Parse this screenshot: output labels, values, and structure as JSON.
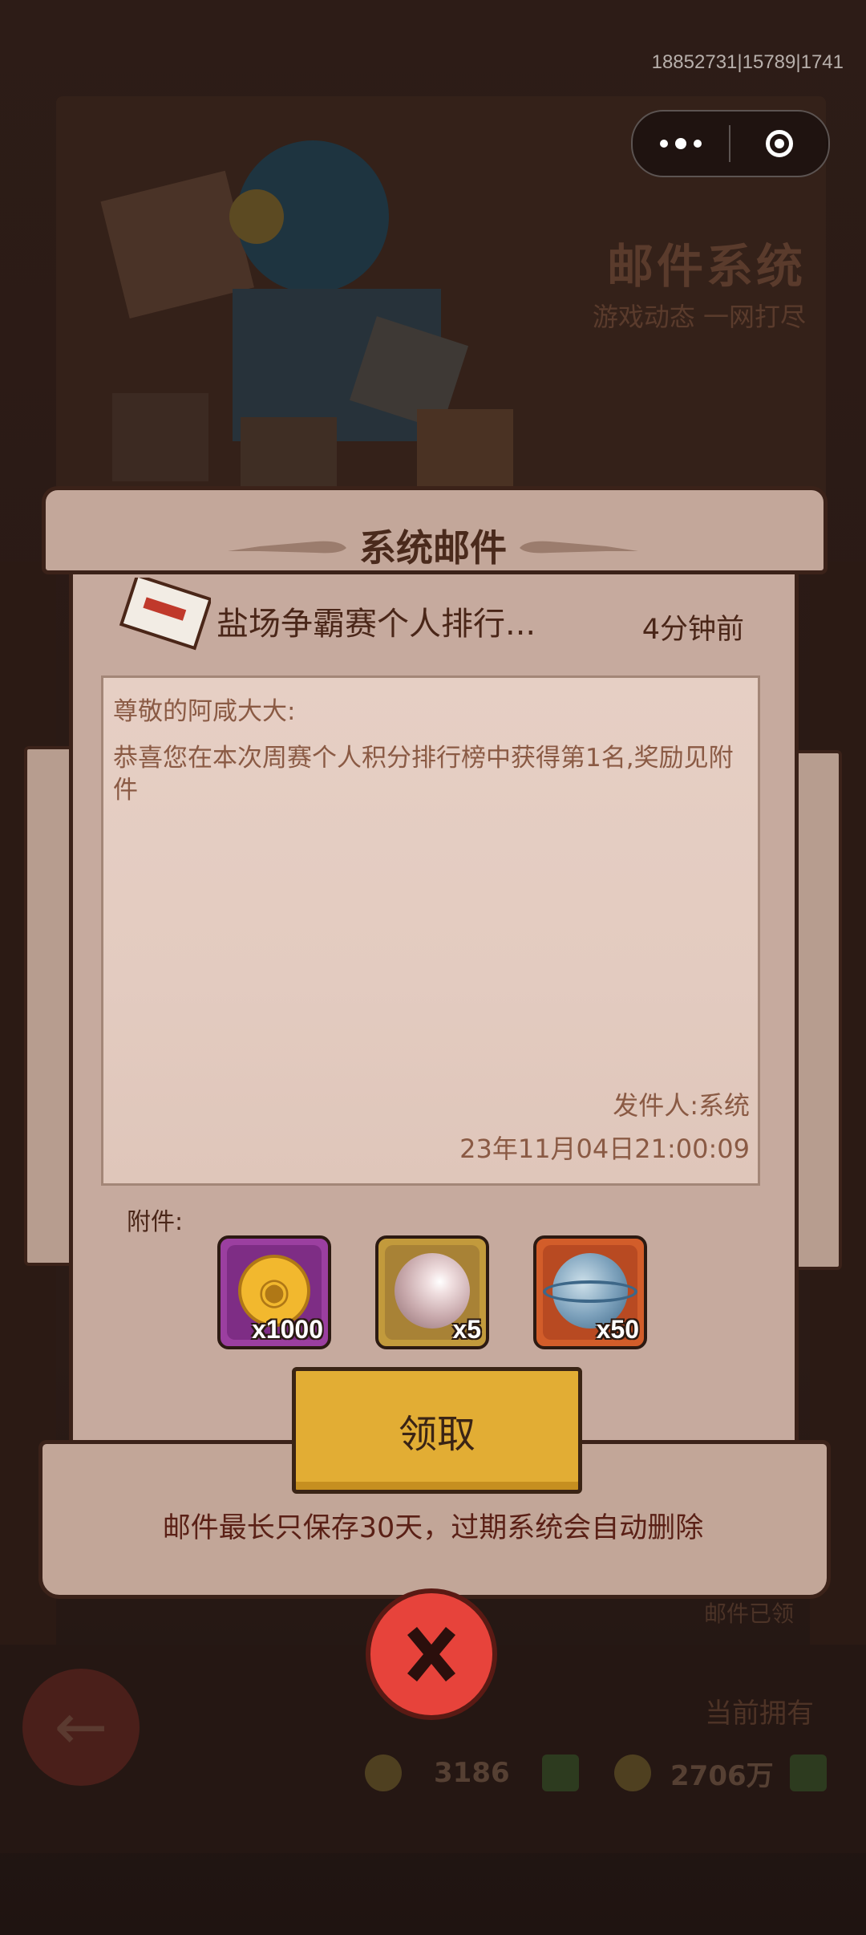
{
  "hud": {
    "debug_id": "18852731|15789|1741",
    "more_icon": "more-dots-icon",
    "close_icon": "target-circle-icon"
  },
  "background": {
    "title": "邮件系统",
    "subtitle": "游戏动态 一网打尽",
    "owned_label": "当前拥有",
    "expired_label": "邮件已领",
    "currency_1": "3186",
    "currency_2": "2706万"
  },
  "dialog": {
    "title": "系统邮件",
    "mail": {
      "subject": "盐场争霸赛个人排行...",
      "time": "4分钟前",
      "greeting": "尊敬的阿咸大大:",
      "body": "恭喜您在本次周赛个人积分排行榜中获得第1名,奖励见附件",
      "sender": "发件人:系统",
      "sent_time": "23年11月04日21:00:09"
    },
    "attachments_label": "附件:",
    "attachments": [
      {
        "name": "fish-coin",
        "qty": "x1000"
      },
      {
        "name": "pearl",
        "qty": "x5"
      },
      {
        "name": "orb",
        "qty": "x50"
      }
    ],
    "claim_label": "领取",
    "notice": "邮件最长只保存30天，过期系统会自动删除"
  },
  "colors": {
    "claim": "#e2ad34",
    "close": "#e7433b",
    "parchment": "#c6aa9e",
    "text_dark": "#4a2618"
  }
}
